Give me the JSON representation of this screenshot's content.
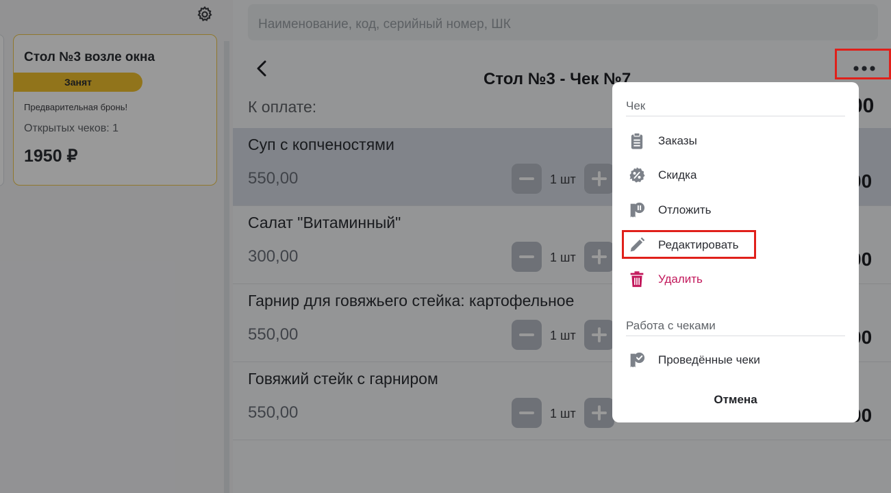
{
  "left": {
    "table_card": {
      "title": "Стол №3 возле окна",
      "status": "Занят",
      "note": "Предварительная бронь!",
      "open_checks": "Открытых чеков: 1",
      "sum": "1950 ₽"
    }
  },
  "search": {
    "placeholder": "Наименование, код, серийный номер, ШК"
  },
  "check": {
    "title": "Стол №3 - Чек №7",
    "to_pay_label": "К оплате:",
    "total_visible": "00"
  },
  "items": [
    {
      "name": "Суп с копченостями",
      "price": "550,00",
      "qty": "1 шт",
      "total_visible": "00",
      "selected": true
    },
    {
      "name": "Салат \"Витаминный\"",
      "price": "300,00",
      "qty": "1 шт",
      "total_visible": "00",
      "selected": false
    },
    {
      "name": "Гарнир для говяжьего стейка: картофельное",
      "price": "550,00",
      "qty": "1 шт",
      "total_visible": "00",
      "selected": false
    },
    {
      "name": "Говяжий стейк с гарниром",
      "price": "550,00",
      "qty": "1 шт",
      "total_visible": "00",
      "selected": false
    }
  ],
  "menu": {
    "section_check": "Чек",
    "section_work": "Работа с чеками",
    "items": {
      "orders": "Заказы",
      "discount": "Скидка",
      "postpone": "Отложить",
      "edit": "Редактировать",
      "delete": "Удалить",
      "completed": "Проведённые чеки"
    },
    "cancel": "Отмена"
  },
  "colors": {
    "accent": "#f2c12e",
    "highlight": "#e0201a",
    "danger": "#c2185b",
    "icon": "#7c8189"
  },
  "icons": {
    "settings": "gear-icon",
    "back": "chevron-left-icon",
    "more": "more-dots-icon",
    "orders": "clipboard-icon",
    "discount": "percent-badge-icon",
    "postpone": "pause-receipt-icon",
    "edit": "pencil-icon",
    "delete": "trash-icon",
    "completed": "check-receipt-icon"
  }
}
